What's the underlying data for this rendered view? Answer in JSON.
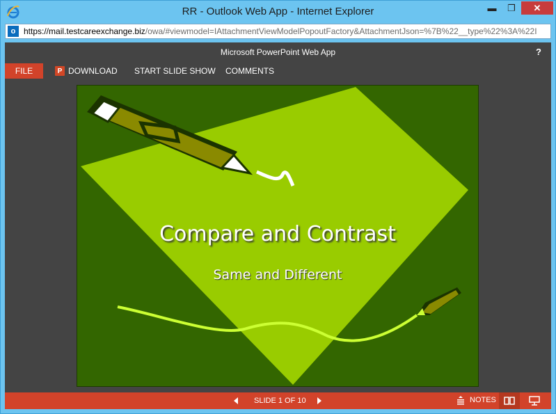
{
  "window": {
    "title": "RR - Outlook Web App - Internet Explorer",
    "address_domain": "https://mail.testcareexchange.biz",
    "address_rest": "/owa/#viewmodel=IAttachmentViewModelPopoutFactory&AttachmentJson=%7B%22__type%22%3A%22I",
    "minimize_label": "▬",
    "maximize_label": "❐",
    "close_label": "✕"
  },
  "app": {
    "title": "Microsoft PowerPoint Web App",
    "help_label": "?"
  },
  "toolbar": {
    "file_label": "FILE",
    "download_label": "DOWNLOAD",
    "download_icon_letter": "P",
    "slideshow_label": "START SLIDE SHOW",
    "comments_label": "COMMENTS"
  },
  "slide": {
    "title": "Compare and Contrast",
    "subtitle": "Same and Different",
    "background_color": "#336600",
    "diamond_color": "#99cc00"
  },
  "status": {
    "slide_counter": "SLIDE 1 OF 10",
    "notes_label": "NOTES",
    "accent_color": "#d2432a"
  }
}
